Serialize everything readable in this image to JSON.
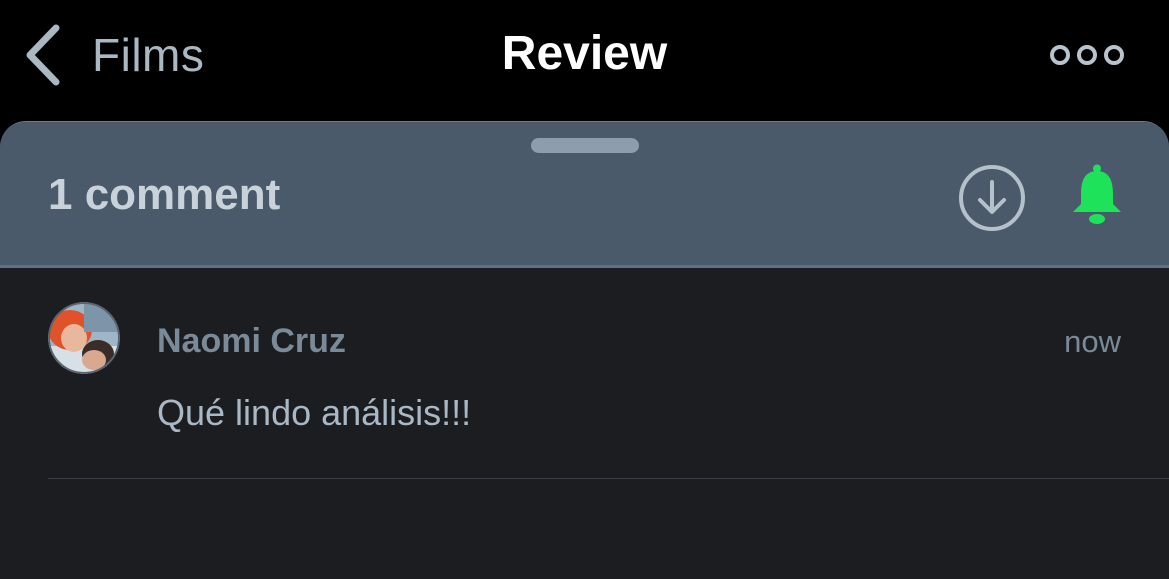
{
  "nav": {
    "back_label": "Films",
    "title": "Review"
  },
  "sheet": {
    "comment_count_label": "1 comment"
  },
  "comments": [
    {
      "author": "Naomi Cruz",
      "time": "now",
      "text": "Qué lindo análisis!!!"
    }
  ],
  "colors": {
    "bell_accent": "#1ee35a",
    "header_bg": "#4a5a6a",
    "sheet_bg": "#1c1d21"
  },
  "icons": {
    "back": "chevron-left-icon",
    "more": "more-options-icon",
    "download": "download-circle-icon",
    "notifications": "bell-icon"
  }
}
